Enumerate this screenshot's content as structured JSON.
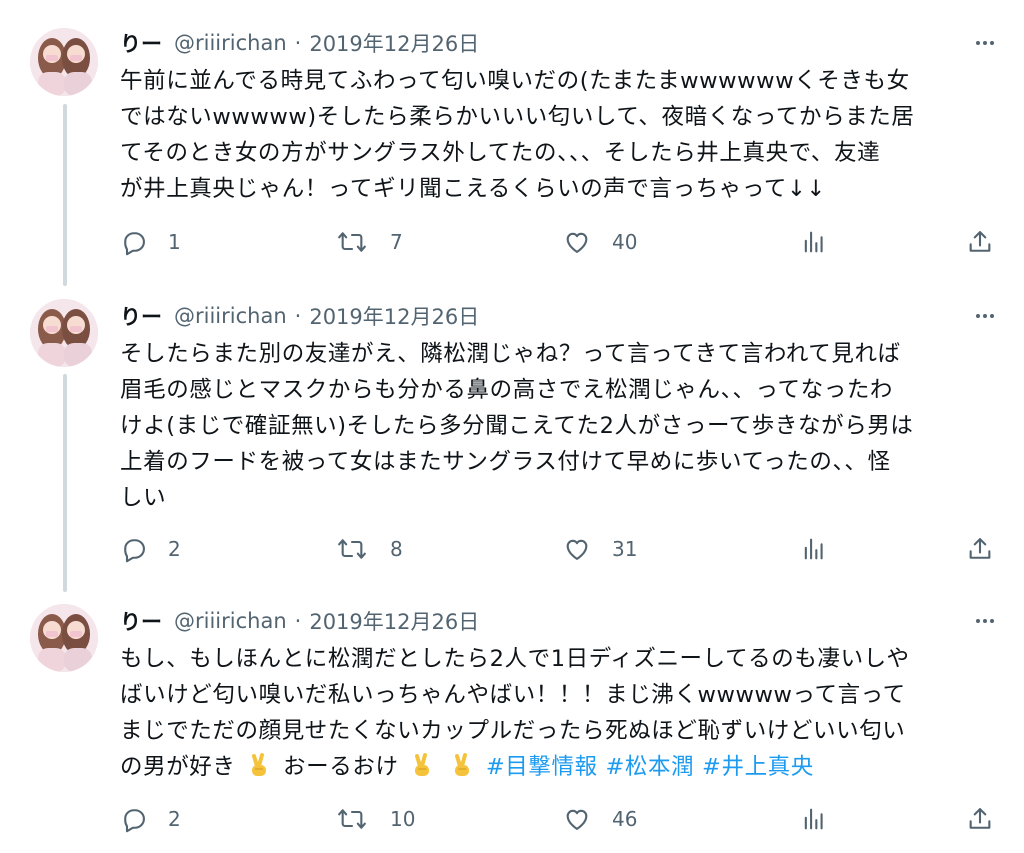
{
  "colors": {
    "text": "#0f1419",
    "secondary": "#536471",
    "link": "#1d9bf0",
    "thread_line": "#cfd9de"
  },
  "tweets": [
    {
      "name": "りー",
      "handle": "@riiirichan",
      "separator": "·",
      "date": "2019年12月26日",
      "lines": [
        "午前に並んでる時見てふわって匂い嗅いだの(たまたまwwwwwwくそきも女",
        "ではないwwwww)そしたら柔らかいいい匂いして、夜暗くなってからまた居",
        "てそのとき女の方がサングラス外してたの、、、そしたら井上真央で、友達",
        "が井上真央じゃん！ってギリ聞こえるくらいの声で言っちゃって↓↓"
      ],
      "replies": "1",
      "retweets": "7",
      "likes": "40"
    },
    {
      "name": "りー",
      "handle": "@riiirichan",
      "separator": "·",
      "date": "2019年12月26日",
      "lines": [
        "そしたらまた別の友達がえ、隣松潤じゃね？って言ってきて言われて見れば",
        "眉毛の感じとマスクからも分かる鼻の高さでえ松潤じゃん、、ってなったわ",
        "けよ(まじで確証無い)そしたら多分聞こえてた2人がさっーて歩きながら男は",
        "上着のフードを被って女はまたサングラス付けて早めに歩いてったの、、怪",
        "しい"
      ],
      "replies": "2",
      "retweets": "8",
      "likes": "31"
    },
    {
      "name": "りー",
      "handle": "@riiirichan",
      "separator": "·",
      "date": "2019年12月26日",
      "lines": [
        "もし、もしほんとに松潤だとしたら2人で1日ディズニーしてるのも凄いしや",
        "ばいけど匂い嗅いだ私いっちゃんやばい！！！まじ沸くwwwwwって言って",
        "まじでただの顔見せたくないカップルだったら死ぬほど恥ずいけどいい匂い"
      ],
      "last_line": {
        "text_a": "の男が好き",
        "text_b": "おーるおけ",
        "hashtags": [
          "#目撃情報",
          "#松本潤",
          "#井上真央"
        ]
      },
      "replies": "2",
      "retweets": "10",
      "likes": "46"
    }
  ]
}
